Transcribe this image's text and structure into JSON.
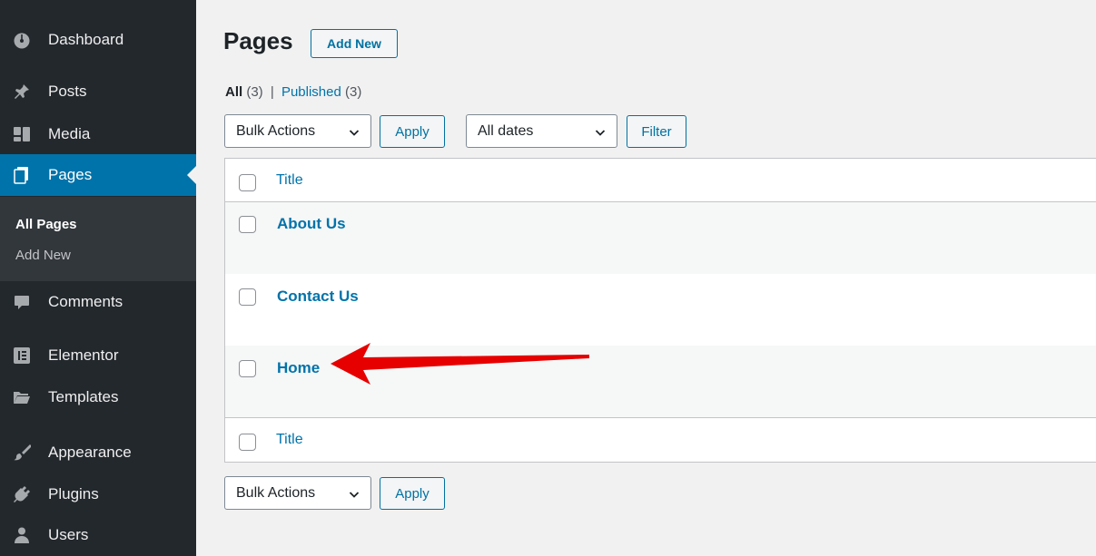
{
  "sidebar": {
    "items": [
      {
        "label": "Dashboard",
        "icon": "dashboard-icon"
      },
      {
        "label": "Posts",
        "icon": "pin-icon"
      },
      {
        "label": "Media",
        "icon": "media-icon"
      },
      {
        "label": "Pages",
        "icon": "pages-icon"
      },
      {
        "label": "Comments",
        "icon": "comment-icon"
      },
      {
        "label": "Elementor",
        "icon": "elementor-icon"
      },
      {
        "label": "Templates",
        "icon": "folder-icon"
      },
      {
        "label": "Appearance",
        "icon": "brush-icon"
      },
      {
        "label": "Plugins",
        "icon": "plugin-icon"
      },
      {
        "label": "Users",
        "icon": "users-icon"
      }
    ],
    "submenu": [
      {
        "label": "All Pages"
      },
      {
        "label": "Add New"
      }
    ]
  },
  "header": {
    "title": "Pages",
    "add_new_label": "Add New"
  },
  "filters": {
    "all_label": "All",
    "all_count": "(3)",
    "separator": "|",
    "published_label": "Published",
    "published_count": "(3)"
  },
  "toolbar_top": {
    "bulk_actions": "Bulk Actions",
    "apply": "Apply",
    "dates": "All dates",
    "filter": "Filter"
  },
  "table": {
    "column_title": "Title",
    "rows": [
      {
        "title": "About Us"
      },
      {
        "title": "Contact Us"
      },
      {
        "title": "Home"
      }
    ],
    "footer_title": "Title"
  },
  "toolbar_bottom": {
    "bulk_actions": "Bulk Actions",
    "apply": "Apply"
  },
  "colors": {
    "sidebar_bg": "#23282d",
    "active_bg": "#0073aa",
    "link": "#0073aa",
    "annotation_arrow": "#e60000"
  }
}
